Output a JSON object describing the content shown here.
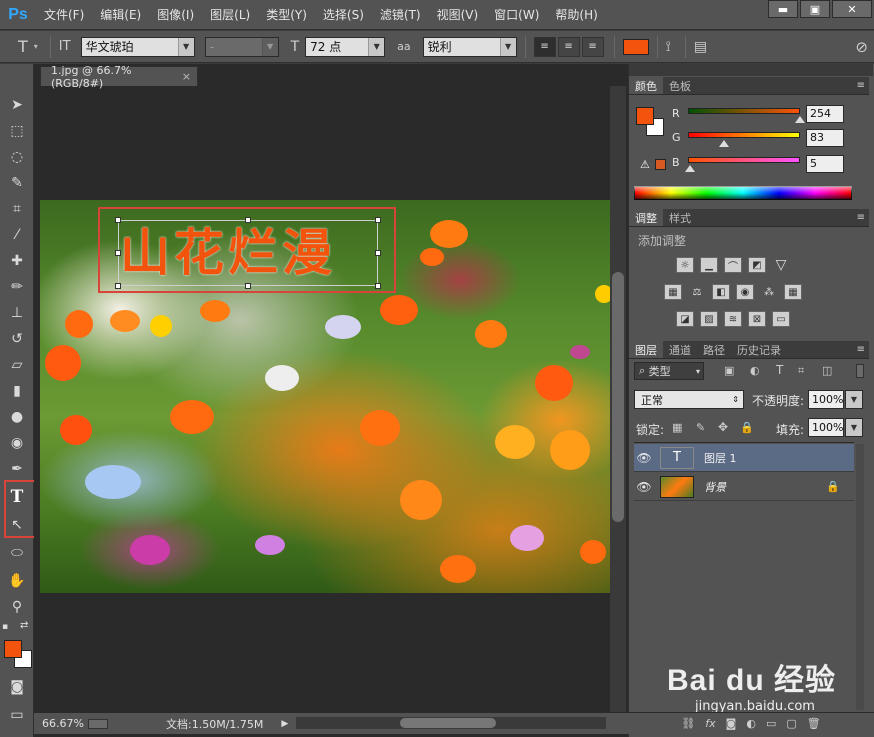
{
  "app": {
    "logo": "Ps"
  },
  "menu": [
    "文件(F)",
    "编辑(E)",
    "图像(I)",
    "图层(L)",
    "类型(Y)",
    "选择(S)",
    "滤镜(T)",
    "视图(V)",
    "窗口(W)",
    "帮助(H)"
  ],
  "window_controls": {
    "minimize": "▬",
    "maximize": "▣",
    "close": "✕"
  },
  "options_bar": {
    "tool_icon": "T",
    "orientation_icon": "IT",
    "font_family": "华文琥珀",
    "font_style": "-",
    "size_icon": "T",
    "font_size": "72 点",
    "aa_icon": "aa",
    "anti_alias": "锐利",
    "text_color": "#f2540e"
  },
  "document": {
    "tab_title": "1.jpg @ 66.7%(RGB/8#)",
    "tab_close": "×",
    "canvas_text": "山花烂漫",
    "zoom": "66.67%",
    "doc_info": "文档:1.50M/1.75M"
  },
  "toolbar": {
    "foreground_color": "#f2540e",
    "background_color": "#ffffff"
  },
  "color_panel": {
    "tabs": [
      "颜色",
      "色板"
    ],
    "r_label": "R",
    "g_label": "G",
    "b_label": "B",
    "r": "254",
    "g": "83",
    "b": "5",
    "r_fraction": 0.996,
    "g_fraction": 0.325,
    "b_fraction": 0.02
  },
  "adjustments_panel": {
    "tabs": [
      "调整",
      "样式"
    ],
    "heading": "添加调整"
  },
  "layers_panel": {
    "tabs": [
      "图层",
      "通道",
      "路径",
      "历史记录"
    ],
    "filter_kind": "类型",
    "blend_mode": "正常",
    "opacity_label": "不透明度:",
    "opacity": "100%",
    "lock_label": "锁定:",
    "fill_label": "填充:",
    "fill": "100%",
    "layers": [
      {
        "name": "图层 1",
        "type": "text",
        "selected": true
      },
      {
        "name": "背景",
        "type": "image",
        "locked": true
      }
    ]
  },
  "watermark": {
    "brand": "Bai du 经验",
    "url": "jingyan.baidu.com"
  }
}
